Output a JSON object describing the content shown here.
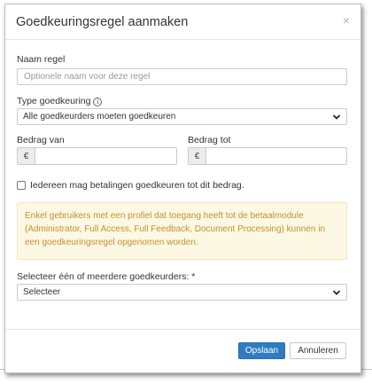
{
  "dialog": {
    "title": "Goedkeuringsregel aanmaken",
    "close_glyph": "×"
  },
  "form": {
    "name_label": "Naam regel",
    "name_placeholder": "Optionele naam voor deze regel",
    "type_label": "Type goedkeuring",
    "type_info_glyph": "i",
    "type_value": "Alle goedkeurders moeten goedkeuren",
    "amount_from_label": "Bedrag van",
    "amount_to_label": "Bedrag tot",
    "currency_symbol": "€",
    "amount_from_value": "",
    "amount_to_value": "",
    "checkbox_label": "Iedereen mag betalingen goedkeuren tot dit bedrag.",
    "checkbox_checked": false,
    "notice_text": "Enkel gebruikers met een profiel dat toegang heeft tot de betaalmodule (Administrator, Full Access, Full Feedback, Document Processing) kunnen in een goedkeuringsregel opgenomen worden.",
    "approvers_label": "Selecteer één of meerdere goedkeurders: *",
    "approvers_value": "Selecteer"
  },
  "footer": {
    "save_label": "Opslaan",
    "cancel_label": "Annuleren"
  },
  "colors": {
    "primary": "#2f7dc0",
    "notice_bg": "#fcf8e3",
    "notice_text": "#c4912e"
  },
  "icons": [
    "close-icon",
    "info-icon",
    "chevron-down-icon"
  ]
}
